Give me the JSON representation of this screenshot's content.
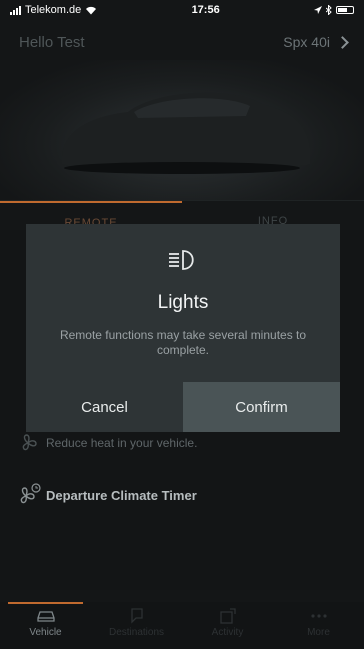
{
  "status_bar": {
    "carrier": "Telekom.de",
    "time": "17:56"
  },
  "header": {
    "greeting": "Hello Test",
    "vehicle": "Spx 40i"
  },
  "tabs": [
    {
      "label": "REMOTE"
    },
    {
      "label": "INFO"
    }
  ],
  "list": {
    "climate_desc": "Reduce heat in your vehicle.",
    "departure_timer": "Departure Climate Timer"
  },
  "modal": {
    "icon": "headlight-icon",
    "title": "Lights",
    "message": "Remote functions may take several minutes to complete.",
    "cancel_label": "Cancel",
    "confirm_label": "Confirm"
  },
  "tab_bar": [
    {
      "label": "Vehicle"
    },
    {
      "label": "Destinations"
    },
    {
      "label": "Activity"
    },
    {
      "label": "More"
    }
  ],
  "colors": {
    "accent": "#c06a2f",
    "modal_bg": "#2e3436",
    "confirm_bg": "#4a5456"
  }
}
